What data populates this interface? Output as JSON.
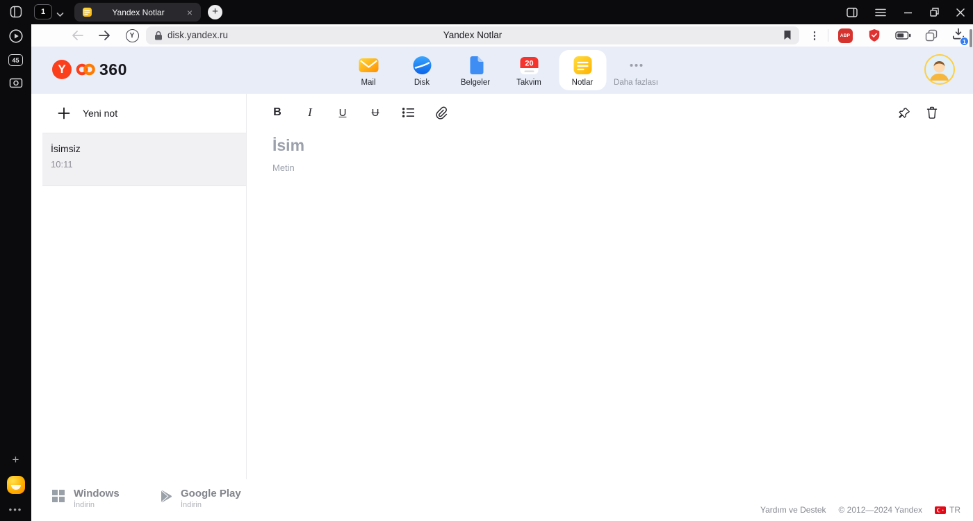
{
  "chrome": {
    "side": {
      "tab_count": "45"
    },
    "tabs": {
      "mini": "1",
      "active_title": "Yandex Notlar"
    },
    "toolbar": {
      "url": "disk.yandex.ru",
      "page_title": "Yandex Notlar",
      "protect_letter": "Y",
      "abp_label": "ABP",
      "download_badge": "1"
    }
  },
  "header": {
    "logo_letter": "Y",
    "logo_text": "360",
    "nav": [
      {
        "label": "Mail"
      },
      {
        "label": "Disk"
      },
      {
        "label": "Belgeler"
      },
      {
        "label": "Takvim",
        "badge": "20"
      },
      {
        "label": "Notlar"
      },
      {
        "label": "Daha fazlası"
      }
    ]
  },
  "notes": {
    "new_note_label": "Yeni not",
    "items": [
      {
        "title": "İsimsiz",
        "time": "10:11"
      }
    ]
  },
  "editor": {
    "bold_label": "B",
    "italic_label": "I",
    "underline_label": "U",
    "strikethrough_label": "U",
    "title_placeholder": "İsim",
    "body_placeholder": "Metin"
  },
  "footer": {
    "windows_title": "Windows",
    "windows_subtitle": "İndirin",
    "gplay_title": "Google Play",
    "gplay_subtitle": "İndirin",
    "help": "Yardım ve Destek",
    "copyright": "© 2012—2024 Yandex",
    "lang": "TR"
  },
  "colors": {
    "accent": "#fb3f1d",
    "header_bg": "#e8edf8",
    "download_badge_bg": "#2f7cf6"
  }
}
